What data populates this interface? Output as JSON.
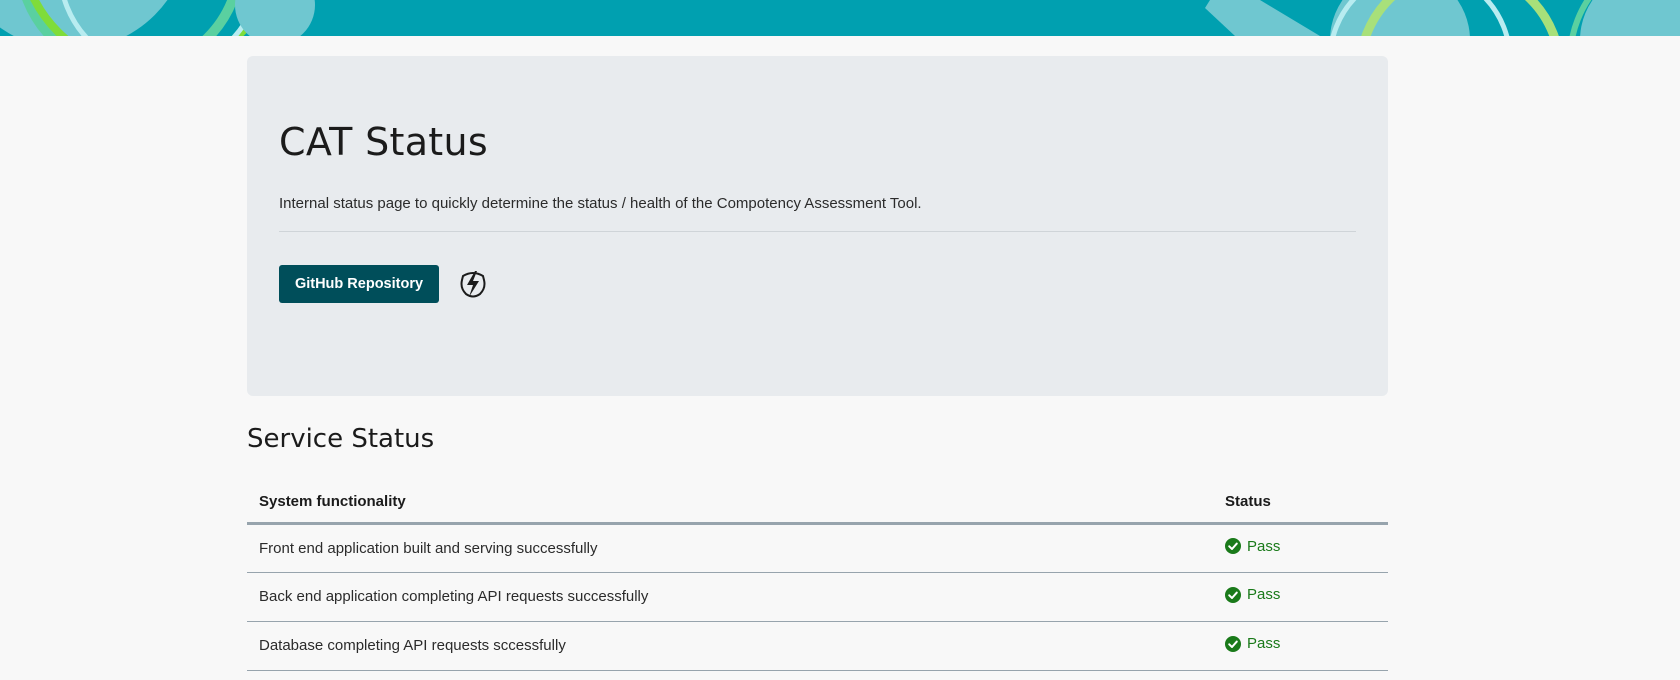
{
  "header": {
    "title": "CAT Status",
    "subtitle": "Internal status page to quickly determine the status / health of the Compotency Assessment Tool.",
    "github_button_label": "GitHub Repository",
    "secondary_icon": "flash-shield-icon"
  },
  "service_status": {
    "title": "Service Status",
    "columns": [
      "System functionality",
      "Status"
    ],
    "rows": [
      {
        "functionality": "Front end application built and serving successfully",
        "status": "Pass"
      },
      {
        "functionality": "Back end application completing API requests successfully",
        "status": "Pass"
      },
      {
        "functionality": "Database completing API requests sccessfully",
        "status": "Pass"
      }
    ]
  },
  "colors": {
    "banner": "#00a0b0",
    "primary_button": "#004e5a",
    "pass": "#1a7a1a"
  }
}
